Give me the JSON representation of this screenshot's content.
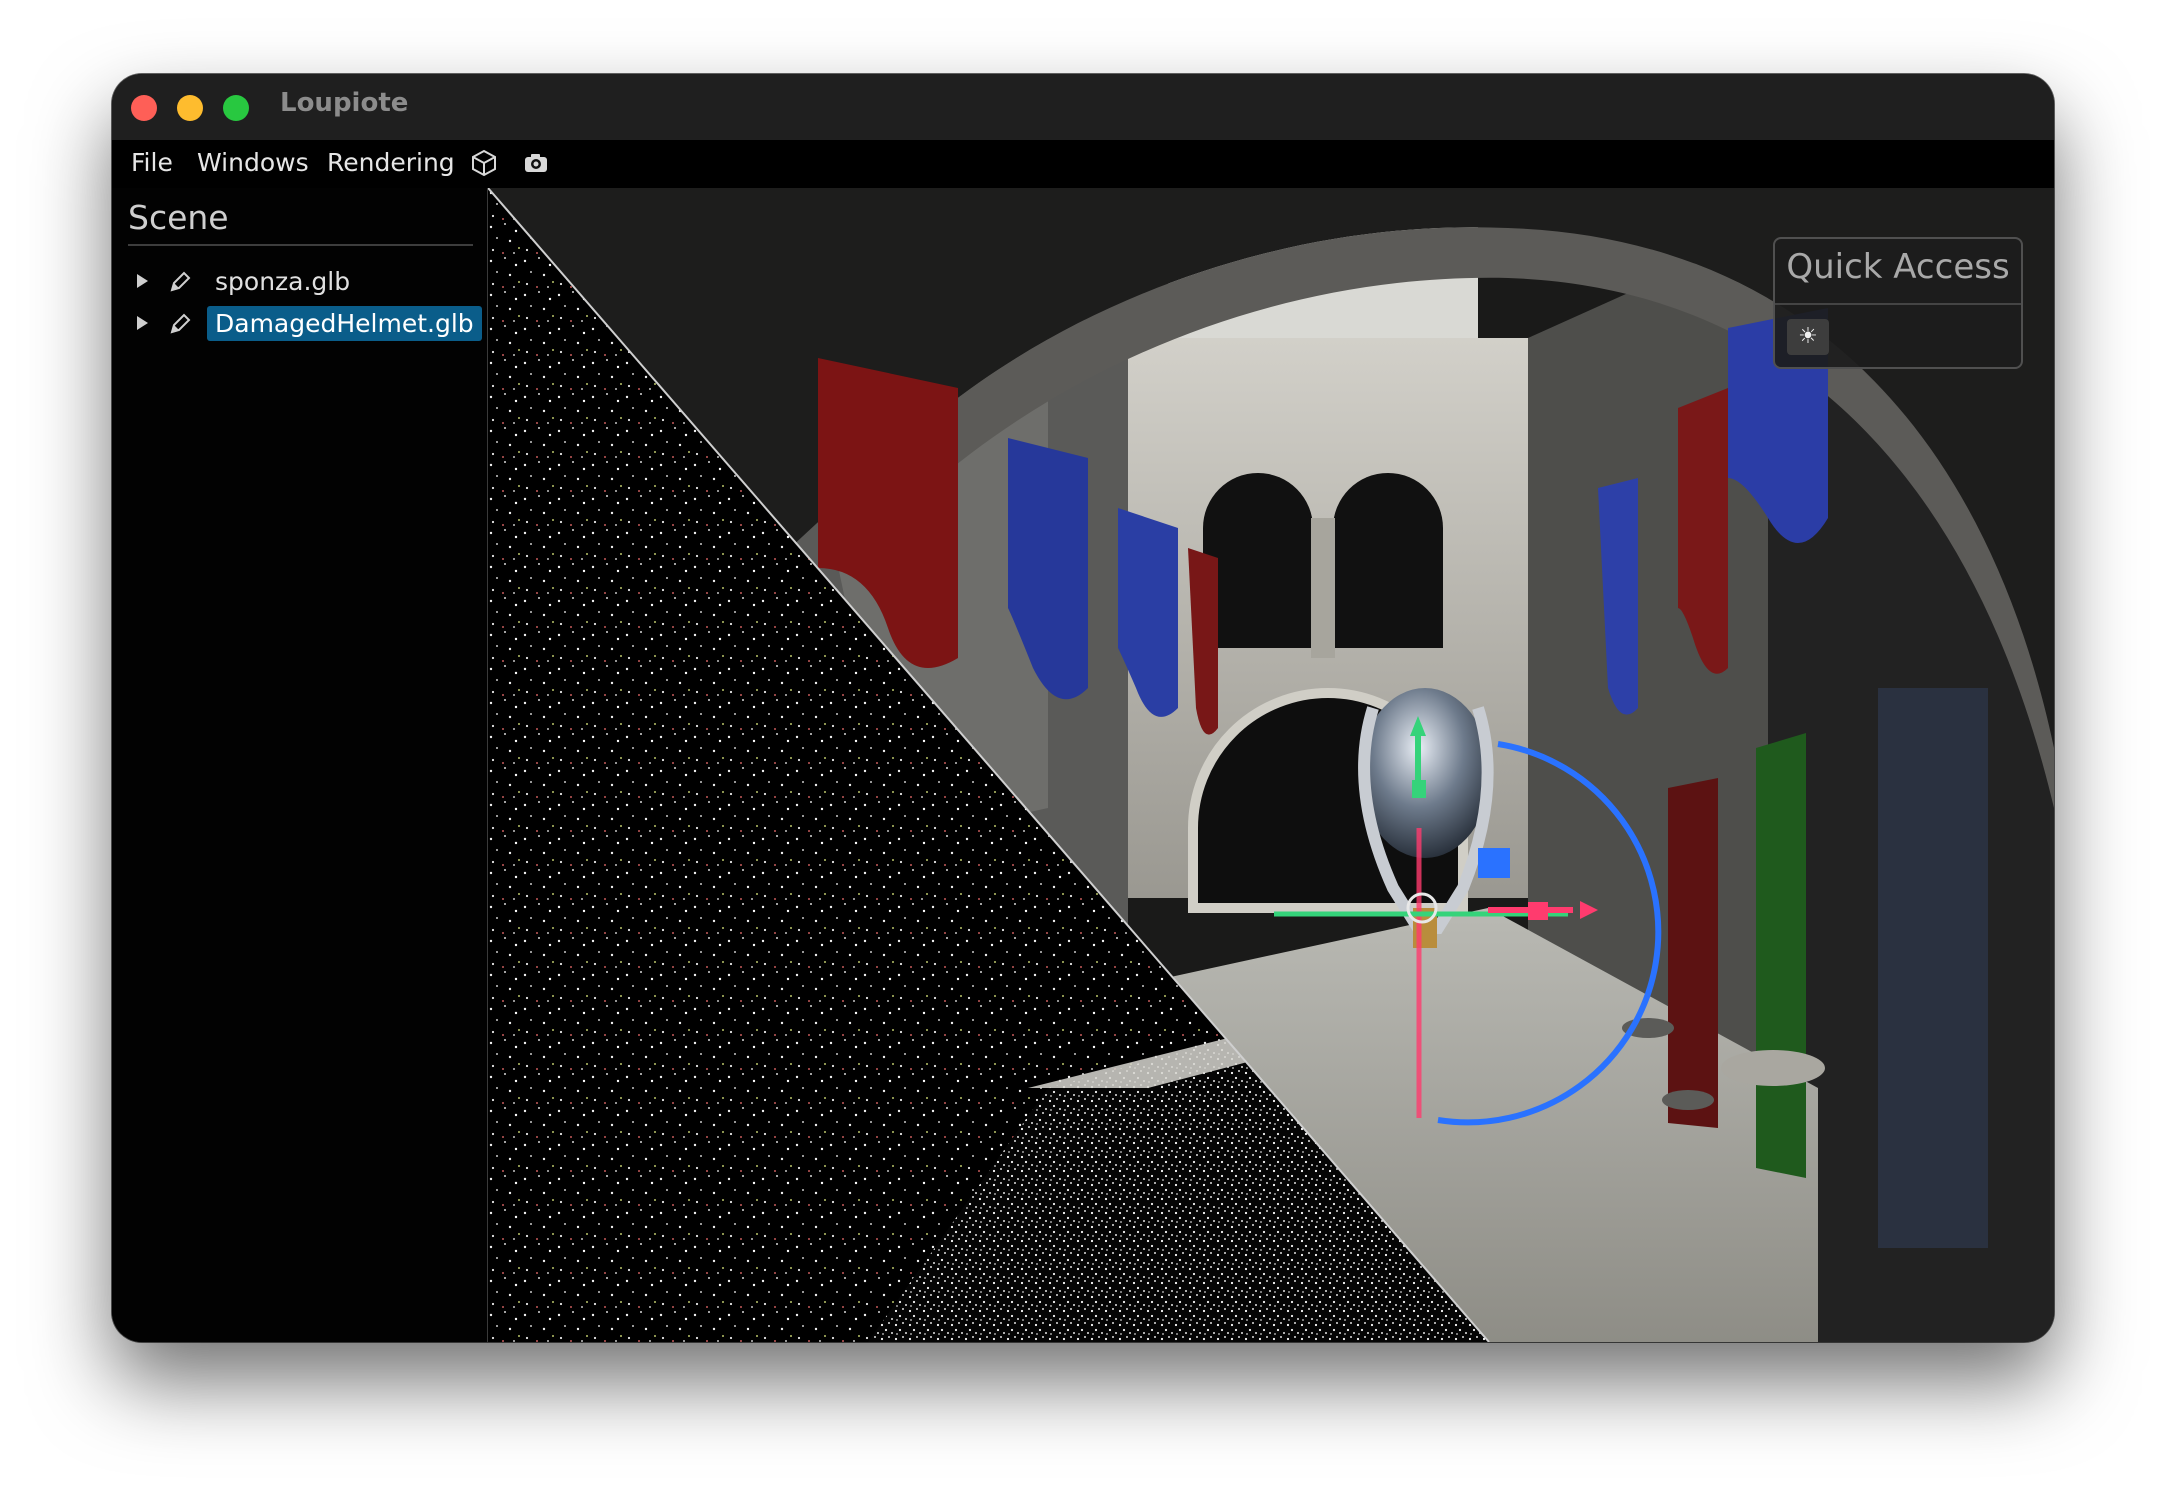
{
  "window": {
    "title": "Loupiote"
  },
  "menubar": {
    "items": [
      "File",
      "Windows",
      "Rendering"
    ],
    "icons": [
      "cube-icon",
      "camera-icon"
    ]
  },
  "scene": {
    "title": "Scene",
    "items": [
      {
        "label": "sponza.glb",
        "selected": false
      },
      {
        "label": "DamagedHelmet.glb",
        "selected": true
      }
    ]
  },
  "quick_access": {
    "title": "Quick Access",
    "buttons": [
      {
        "icon": "sun-icon",
        "glyph": "☀"
      }
    ]
  },
  "colors": {
    "selection": "#0a5d8a",
    "gizmo_x": "#ff3b6e",
    "gizmo_y": "#35d37a",
    "gizmo_z": "#2a72ff"
  }
}
